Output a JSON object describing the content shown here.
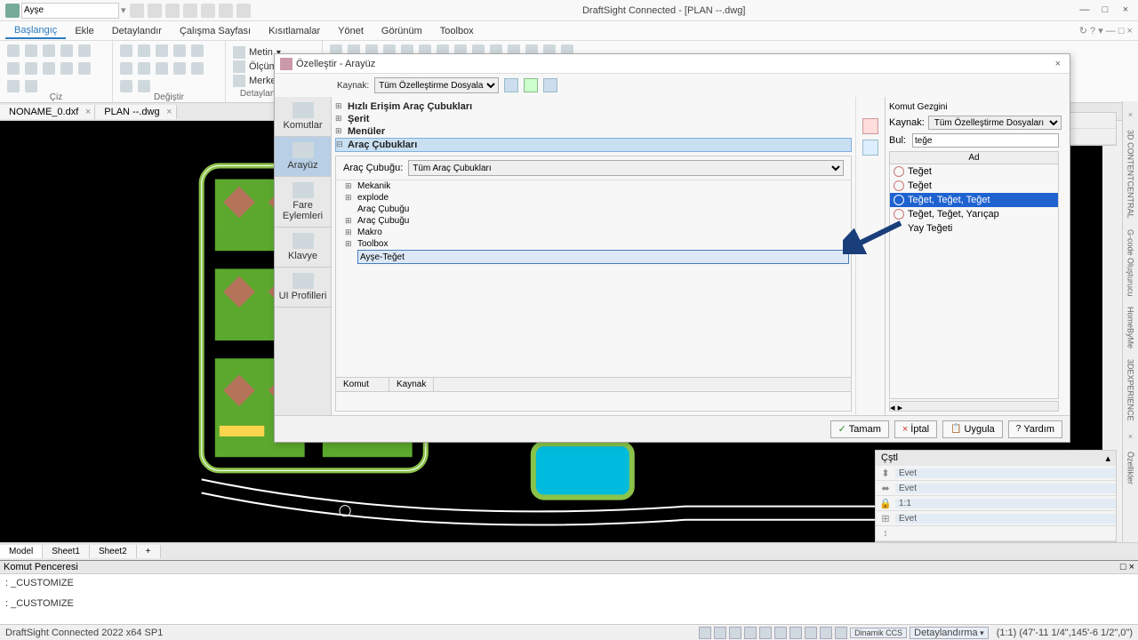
{
  "app": {
    "title": "DraftSight Connected - [PLAN --.dwg]",
    "combo_value": "Ayşe"
  },
  "menubar": {
    "tabs": [
      "Başlangıç",
      "Ekle",
      "Detaylandır",
      "Çalışma Sayfası",
      "Kısıtlamalar",
      "Yönet",
      "Görünüm",
      "Toolbox"
    ]
  },
  "ribbon": {
    "groups": [
      {
        "label": "Çiz"
      },
      {
        "label": "Değiştir"
      },
      {
        "label": "Detaylandırmalar"
      }
    ],
    "text_items": [
      "Metin",
      "Ölçümlendirme",
      "Merkez çizgisi"
    ]
  },
  "doc_tabs": [
    {
      "name": "NONAME_0.dxf"
    },
    {
      "name": "PLAN --.dwg"
    }
  ],
  "dialog": {
    "title": "Özelleştir - Arayüz",
    "source_label": "Kaynak:",
    "source_value": "Tüm Özelleştirme Dosyaları",
    "sidebar": [
      "Komutlar",
      "Arayüz",
      "Fare Eylemleri",
      "Klavye",
      "UI Profilleri"
    ],
    "tree": [
      {
        "label": "Hızlı Erişim Araç Çubukları",
        "bold": true
      },
      {
        "label": "Şerit",
        "bold": true
      },
      {
        "label": "Menüler",
        "bold": true
      },
      {
        "label": "Araç Çubukları",
        "bold": true,
        "selected": true
      }
    ],
    "toolbar_label": "Araç Çubuğu:",
    "toolbar_value": "Tüm Araç Çubukları",
    "toolbar_items": [
      "Mekanik",
      "explode",
      "Araç Çubuğu",
      "Araç Çubuğu",
      "Makro",
      "Toolbox"
    ],
    "edit_value": "Ayşe-Teğet",
    "table_headers": [
      "Komut",
      "Kaynak"
    ],
    "cmd_explorer": {
      "title": "Komut Gezgini",
      "source_label": "Kaynak:",
      "source_value": "Tüm Özelleştirme Dosyaları",
      "find_label": "Bul:",
      "find_value": "teğe",
      "col": "Ad",
      "results": [
        {
          "name": "Teğet"
        },
        {
          "name": "Teğet"
        },
        {
          "name": "Teğet, Teğet, Teğet",
          "selected": true
        },
        {
          "name": "Teğet, Teğet, Yarıçap"
        },
        {
          "name": "Yay Teğeti"
        }
      ]
    },
    "buttons": {
      "ok": "Tamam",
      "cancel": "İptal",
      "apply": "Uygula",
      "help": "Yardım"
    }
  },
  "props_panel": {
    "title": "Çştl",
    "rows": [
      "Evet",
      "Evet",
      "1:1",
      "Evet",
      ""
    ]
  },
  "right_rail": [
    "3D CONTENTCENTRAL",
    "G-code Oluşturucu",
    "HomeByMe",
    "3DEXPERIENCE",
    "Özellikler"
  ],
  "bottom_tabs": [
    "Model",
    "Sheet1",
    "Sheet2"
  ],
  "cmd_window": {
    "title": "Komut Penceresi",
    "lines": [
      ": _CUSTOMIZE",
      ": _CUSTOMIZE"
    ]
  },
  "statusbar": {
    "left": "DraftSight Connected 2022  x64 SP1",
    "btn1": "Dinamik CCS",
    "btn2": "Detaylandırma",
    "coords": "(1:1)  (47'-11 1/4\",145'-6 1/2\",0\")"
  }
}
